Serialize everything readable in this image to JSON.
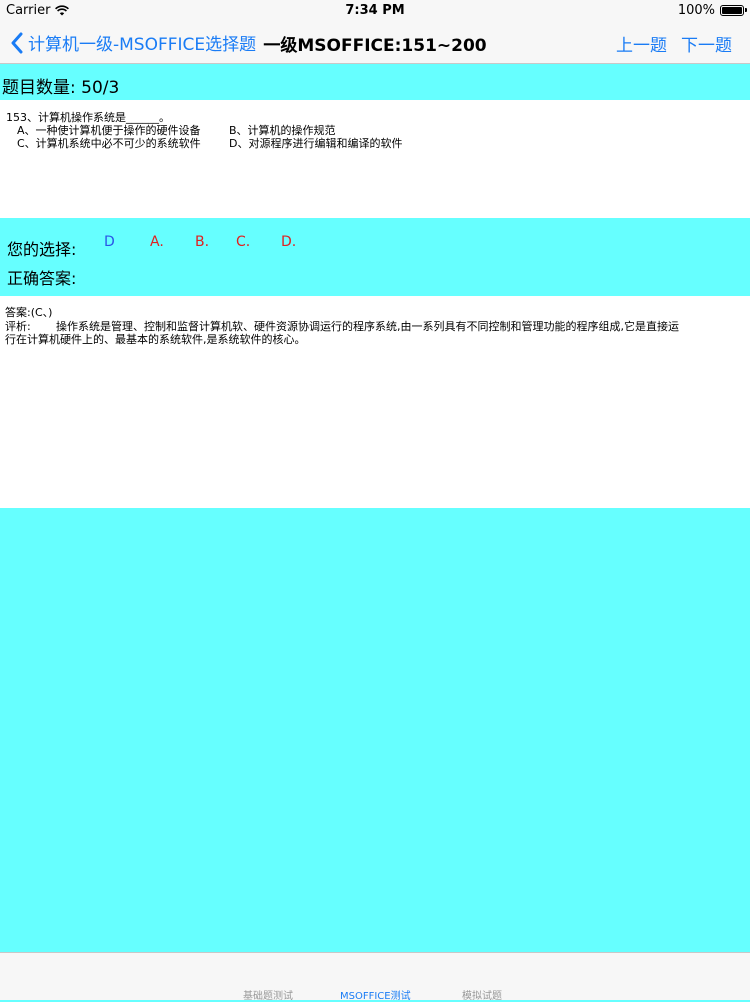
{
  "status_bar": {
    "carrier": "Carrier",
    "time": "7:34 PM",
    "battery": "100%"
  },
  "nav": {
    "back_label": "计算机一级-MSOFFICE选择题",
    "title": "一级MSOFFICE:151~200",
    "prev_label": "上一题",
    "next_label": "下一题"
  },
  "count": {
    "text": "题目数量:  50/3"
  },
  "question": {
    "stem": "153、计算机操作系统是______。",
    "option_a": "A、一种使计算机便于操作的硬件设备",
    "option_b": "B、计算机的操作规范",
    "option_c": "C、计算机系统中必不可少的系统软件",
    "option_d": "D、对源程序进行编辑和编译的软件"
  },
  "choices": {
    "your_choice_label": "您的选择:",
    "correct_answer_label": "正确答案:",
    "selected": "D",
    "options": [
      "A.",
      "B.",
      "C.",
      "D."
    ],
    "colors": {
      "selected": "#2a55e6",
      "option": "#e02020"
    }
  },
  "explanation": {
    "answer": "答案:(C、)",
    "analysis_label": "评析:",
    "analysis_line1": "操作系统是管理、控制和监督计算机软、硬件资源协调运行的程序系统,由一系列具有不同控制和管理功能的程序组成,它是直接运",
    "analysis_line2": "行在计算机硬件上的、最基本的系统软件,是系统软件的核心。"
  },
  "tabs": [
    {
      "label": "基础题测试",
      "active": false
    },
    {
      "label": "MSOFFICE测试",
      "active": true
    },
    {
      "label": "模拟试题",
      "active": false
    }
  ],
  "colors": {
    "accent": "#1a7cf5",
    "background": "#66ffff",
    "panel": "#ffffff"
  }
}
